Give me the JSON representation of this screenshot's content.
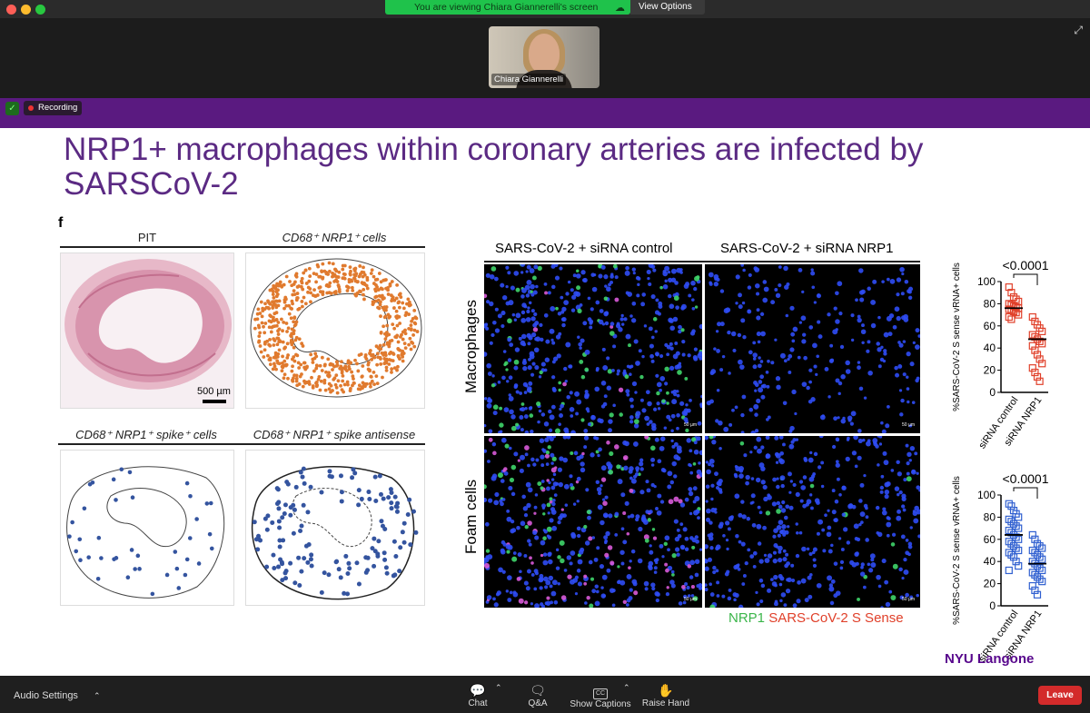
{
  "window": {
    "traffic_lights": [
      "#fe5f57",
      "#febc2e",
      "#28c840"
    ]
  },
  "banner": {
    "text": "You are viewing Chiara Giannerelli's screen",
    "view_options": "View Options"
  },
  "video": {
    "participant_name": "Chiara Giannerelli"
  },
  "status": {
    "recording": "Recording"
  },
  "slide": {
    "title": "NRP1+ macrophages within coronary arteries are infected by SARSCoV-2",
    "panel_letter": "f",
    "histology": {
      "pit": "PIT",
      "cd68_nrp1": "CD68⁺ NRP1⁺ cells",
      "scale_bar": "500 µm",
      "spike": "CD68⁺ NRP1⁺ spike⁺ cells",
      "antisense": "CD68⁺ NRP1⁺ spike antisense"
    },
    "microscopy": {
      "col1": "SARS-CoV-2 + siRNA control",
      "col2": "SARS-CoV-2 + siRNA NRP1",
      "row1": "Macrophages",
      "row2": "Foam cells",
      "scale": "50 µm",
      "legend_nrp1": "NRP1",
      "legend_sense": "SARS-CoV-2 S Sense"
    },
    "logo": "NYU Langone"
  },
  "chart_data": [
    {
      "type": "scatter",
      "title": "<0.0001",
      "ylabel": "%SARS-CoV-2 S sense vRNA+ cells",
      "categories": [
        "siRNA control",
        "siRNA NRP1"
      ],
      "ylim": [
        0,
        100
      ],
      "yticks": [
        0,
        20,
        40,
        60,
        80,
        100
      ],
      "series": [
        {
          "values": [
            95,
            90,
            86,
            84,
            82,
            80,
            79,
            78,
            77,
            76,
            75,
            74,
            73,
            72,
            70,
            68,
            66
          ],
          "color": "#e0402a",
          "median": 76
        },
        {
          "values": [
            68,
            64,
            61,
            58,
            55,
            52,
            50,
            48,
            46,
            44,
            42,
            38,
            34,
            30,
            26,
            22,
            18,
            14,
            10
          ],
          "color": "#e0402a",
          "median": 48
        }
      ]
    },
    {
      "type": "scatter",
      "title": "<0.0001",
      "ylabel": "%SARS-CoV-2 S sense vRNA+ cells",
      "categories": [
        "siRNA control",
        "siRNA NRP1"
      ],
      "ylim": [
        0,
        100
      ],
      "yticks": [
        0,
        20,
        40,
        60,
        80,
        100
      ],
      "series": [
        {
          "values": [
            92,
            90,
            86,
            83,
            80,
            78,
            76,
            74,
            72,
            70,
            68,
            66,
            64,
            62,
            60,
            58,
            56,
            54,
            52,
            50,
            48,
            46,
            44,
            40,
            36,
            32
          ],
          "color": "#2f5fd0",
          "median": 64
        },
        {
          "values": [
            64,
            60,
            56,
            54,
            52,
            50,
            48,
            46,
            44,
            42,
            40,
            38,
            36,
            34,
            32,
            30,
            28,
            26,
            24,
            22,
            18,
            14,
            10
          ],
          "color": "#2f5fd0",
          "median": 38
        }
      ]
    }
  ],
  "toolbar": {
    "audio": "Audio Settings",
    "chat": "Chat",
    "qa": "Q&A",
    "captions": "Show Captions",
    "cc": "CC",
    "raise": "Raise Hand",
    "leave": "Leave"
  }
}
